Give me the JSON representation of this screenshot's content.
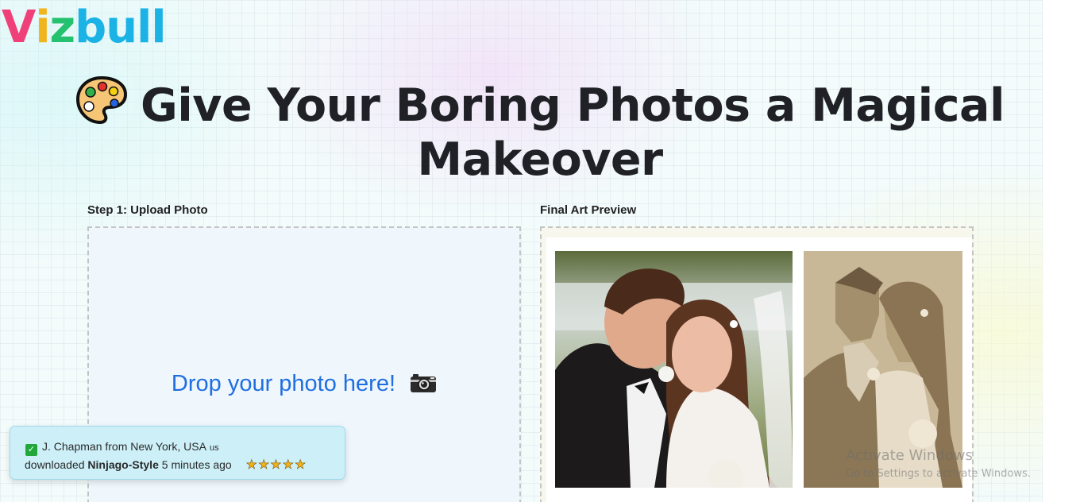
{
  "brand": {
    "letters": [
      {
        "char": "V",
        "color": "#f0407a"
      },
      {
        "char": "i",
        "color": "#f2b41c"
      },
      {
        "char": "z",
        "color": "#24c16e"
      },
      {
        "char": "b",
        "color": "#1bb2e6"
      },
      {
        "char": "u",
        "color": "#1bb2e6"
      },
      {
        "char": "l",
        "color": "#1bb2e6"
      },
      {
        "char": "l",
        "color": "#1bb2e6"
      }
    ]
  },
  "hero": {
    "icon": "artist-palette-icon",
    "line1": "Give Your Boring Photos a Magical",
    "line2": "Makeover"
  },
  "upload": {
    "label": "Step 1: Upload Photo",
    "drop_text": "Drop your photo here!",
    "icon": "camera-icon"
  },
  "preview": {
    "label": "Final Art Preview"
  },
  "toast": {
    "name_location": "J. Chapman from New York, USA",
    "country_code": "us",
    "prefix": "downloaded",
    "style_name": "Ninjago-Style",
    "time": "5 minutes ago",
    "stars": "★★★★★",
    "rating": 5
  },
  "watermark": {
    "title": "Activate Windows",
    "subtitle": "Go to Settings to activate Windows."
  }
}
